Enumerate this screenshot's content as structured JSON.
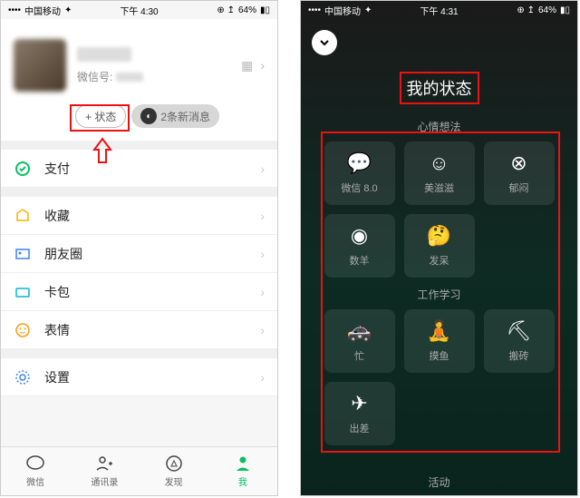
{
  "status_left": {
    "carrier": "中国移动",
    "time": "下午 4:30",
    "battery": "64%"
  },
  "status_right": {
    "carrier": "中国移动",
    "time": "下午 4:31",
    "battery": "64%"
  },
  "profile": {
    "wxid_label": "微信号:",
    "status_btn": "+ 状态",
    "msg_btn": "2条新消息"
  },
  "rows": {
    "pay": "支付",
    "fav": "收藏",
    "moments": "朋友圈",
    "cards": "卡包",
    "stickers": "表情",
    "settings": "设置"
  },
  "tabs": {
    "chat": "微信",
    "contacts": "通讯录",
    "discover": "发现",
    "me": "我"
  },
  "my_status": {
    "title": "我的状态",
    "group1": "心情想法",
    "group2": "工作学习",
    "group3": "活动",
    "items1": [
      {
        "label": "微信 8.0",
        "icon": "💬"
      },
      {
        "label": "美滋滋",
        "icon": "☺"
      },
      {
        "label": "郁闷",
        "icon": "⊗"
      },
      {
        "label": "数羊",
        "icon": "◉"
      },
      {
        "label": "发呆",
        "icon": "🤔"
      }
    ],
    "items2": [
      {
        "label": "忙",
        "icon": "🚓"
      },
      {
        "label": "摸鱼",
        "icon": "🧘"
      },
      {
        "label": "搬砖",
        "icon": "⛏"
      },
      {
        "label": "出差",
        "icon": "✈"
      }
    ]
  }
}
